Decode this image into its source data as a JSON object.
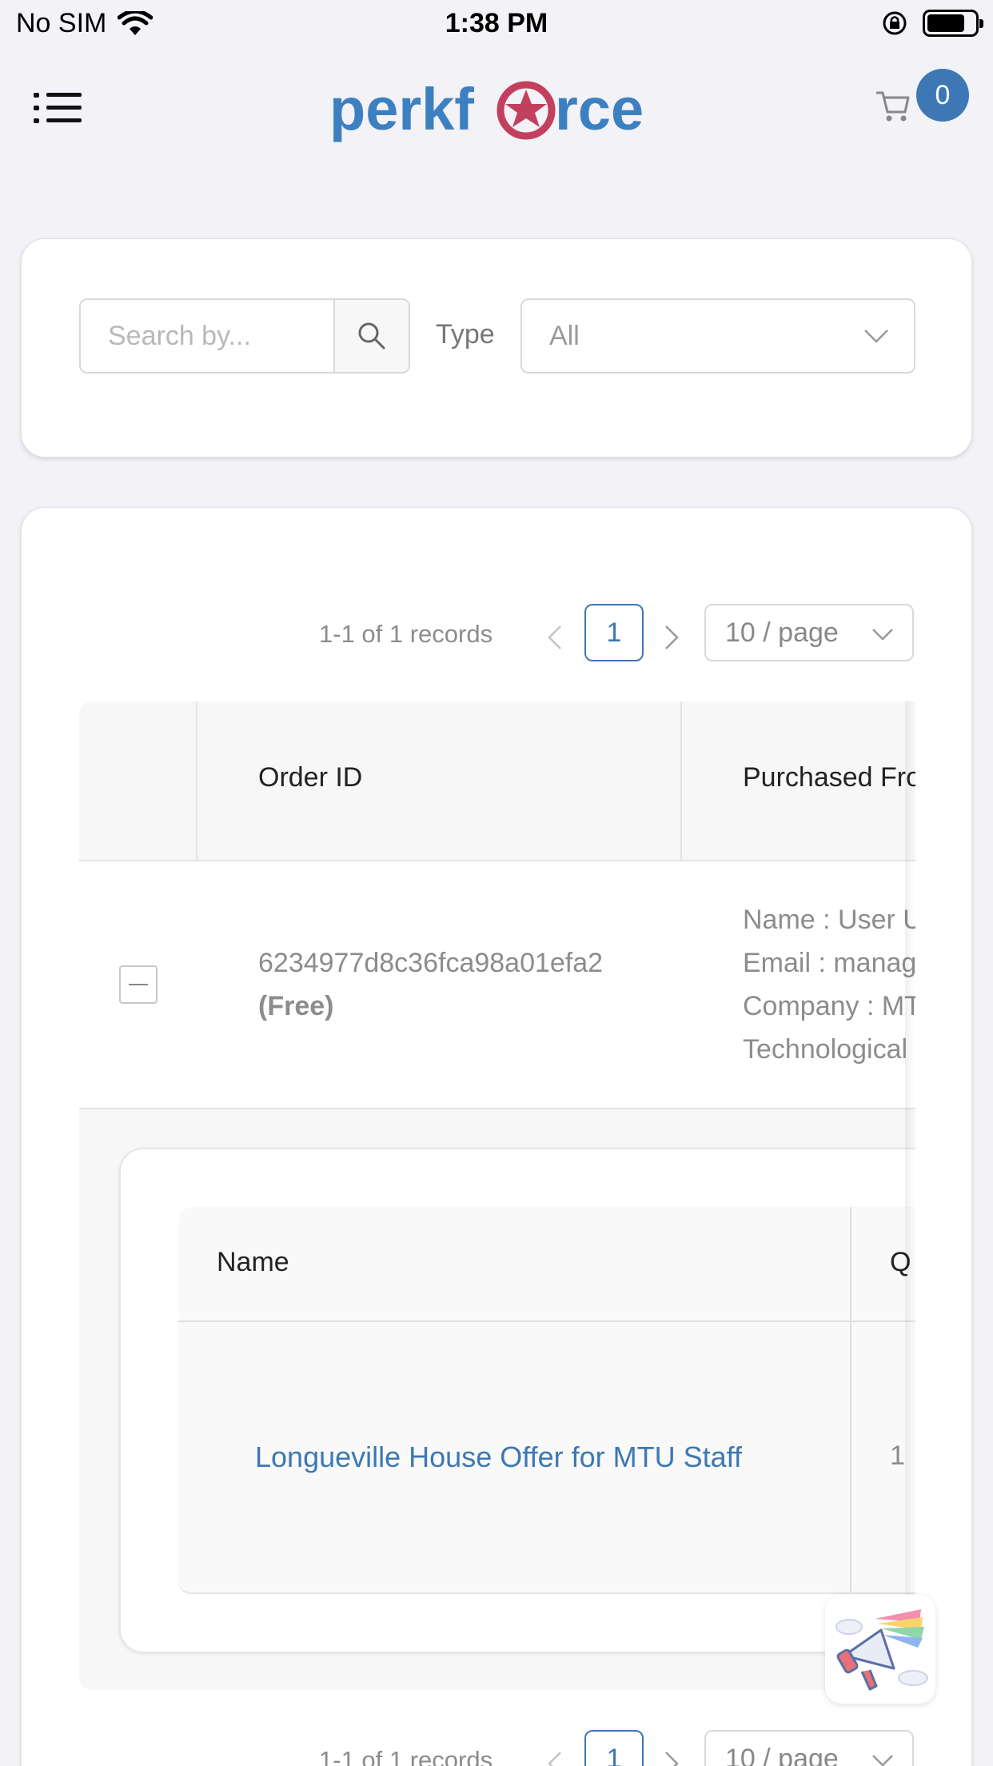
{
  "status_bar": {
    "carrier": "No SIM",
    "time": "1:38 PM"
  },
  "header": {
    "logo_text": "perkforce",
    "cart_count": "0",
    "brand_color": "#3d80c1",
    "logo_accent_color": "#c2405e"
  },
  "filters": {
    "search_placeholder": "Search by...",
    "type_label": "Type",
    "type_value": "All"
  },
  "pagination": {
    "records": "1-1 of 1 records",
    "current_page": "1",
    "page_size": "10 / page",
    "prev_icon": "chevron-left-icon",
    "next_icon": "chevron-right-icon"
  },
  "orders_table": {
    "columns": [
      "Order ID",
      "Purchased Fro"
    ],
    "rows": [
      {
        "order_id": "6234977d8c36fca98a01efa2",
        "order_tag": "(Free)",
        "purchased_from": {
          "name": "Name : User U",
          "email": "Email : manage",
          "company": "Company : MT",
          "company_cont": "Technological"
        }
      }
    ]
  },
  "order_items": {
    "columns": [
      "Name",
      "Q"
    ],
    "rows": [
      {
        "name": "Longueville House Offer for MTU Staff",
        "qty": "1"
      }
    ]
  },
  "bottom_pagination": {
    "records": "1-1 of 1 records",
    "current_page": "1",
    "page_size": "10 / page"
  }
}
